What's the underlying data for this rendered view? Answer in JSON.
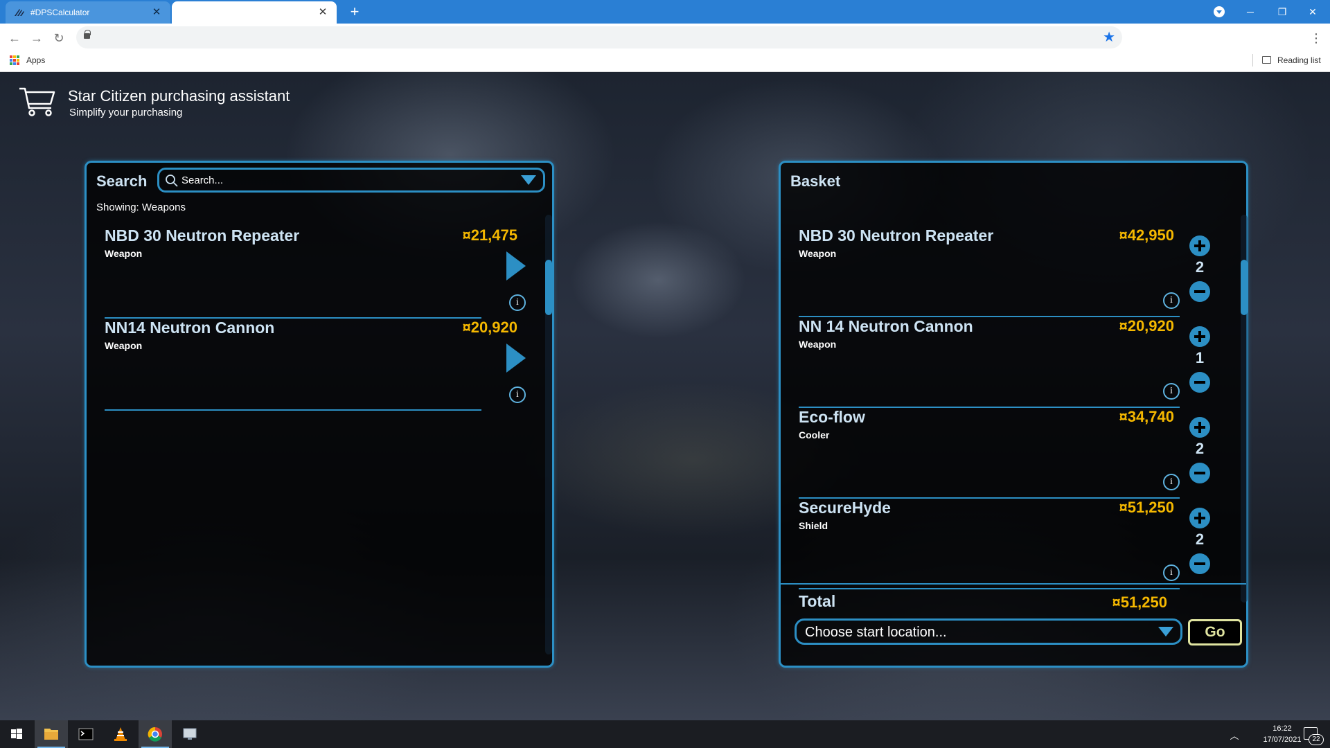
{
  "browser": {
    "tabs": [
      {
        "title": "#DPSCalculator",
        "active": false
      },
      {
        "title": "",
        "active": true
      }
    ],
    "new_tab_label": "+",
    "bookmarks": {
      "apps_label": "Apps",
      "reading_list_label": "Reading list"
    }
  },
  "header": {
    "title": "Star Citizen purchasing assistant",
    "subtitle": "Simplify your purchasing"
  },
  "search_panel": {
    "title": "Search",
    "search_placeholder": "Search...",
    "showing": "Showing: Weapons",
    "results": [
      {
        "name": "NBD 30 Neutron Repeater",
        "type": "Weapon",
        "price": "¤21,475"
      },
      {
        "name": "NN14 Neutron Cannon",
        "type": "Weapon",
        "price": "¤20,920"
      }
    ]
  },
  "basket_panel": {
    "title": "Basket",
    "items": [
      {
        "name": "NBD 30 Neutron Repeater",
        "type": "Weapon",
        "price": "¤42,950",
        "quantity": "2"
      },
      {
        "name": "NN 14 Neutron Cannon",
        "type": "Weapon",
        "price": "¤20,920",
        "quantity": "1"
      },
      {
        "name": "Eco-flow",
        "type": "Cooler",
        "price": "¤34,740",
        "quantity": "2"
      },
      {
        "name": "SecureHyde",
        "type": "Shield",
        "price": "¤51,250",
        "quantity": "2"
      }
    ],
    "total_label": "Total",
    "total_value": "¤51,250",
    "location_placeholder": "Choose start location...",
    "go_label": "Go"
  },
  "info_glyph": "i",
  "taskbar": {
    "time": "16:22",
    "date": "17/07/2021",
    "notification_count": "22"
  },
  "colors": {
    "accent": "#2c8fc4",
    "price": "#f5b800",
    "chrome_blue": "#2a7fd4",
    "go_button": "#e0e4a0"
  },
  "icons": [
    "cart-icon",
    "search-icon",
    "play-icon",
    "info-icon",
    "plus-icon",
    "minus-icon",
    "chevron-down-icon",
    "star-icon",
    "lock-icon"
  ]
}
